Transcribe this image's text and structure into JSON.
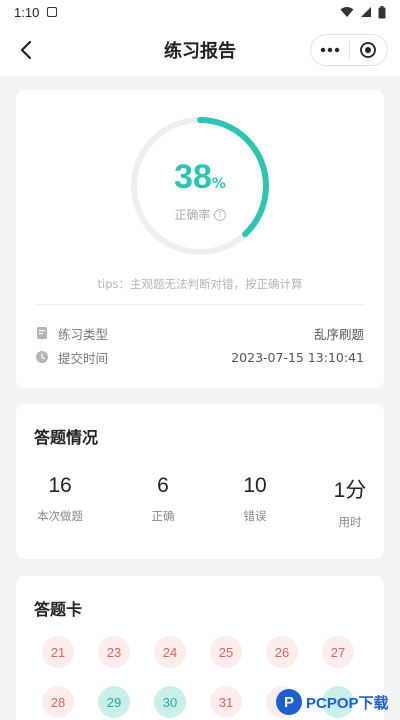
{
  "status_bar": {
    "time": "1:10"
  },
  "nav": {
    "title": "练习报告"
  },
  "report": {
    "accuracy_value": "38",
    "accuracy_unit": "%",
    "accuracy_fraction": 0.38,
    "accuracy_label": "正确率",
    "help_glyph": "?",
    "tips": "tips：主观题无法判断对错，按正确计算",
    "type_label": "练习类型",
    "type_value": "乱序刷题",
    "submit_label": "提交时间",
    "submit_value": "2023-07-15 13:10:41"
  },
  "summary": {
    "title": "答题情况",
    "stats": [
      {
        "value": "16",
        "label": "本次做题"
      },
      {
        "value": "6",
        "label": "正确"
      },
      {
        "value": "10",
        "label": "错误"
      },
      {
        "value": "1分",
        "label": "用时"
      }
    ]
  },
  "answer_card": {
    "title": "答题卡",
    "items": [
      {
        "num": "21",
        "status": "wrong"
      },
      {
        "num": "23",
        "status": "wrong"
      },
      {
        "num": "24",
        "status": "wrong"
      },
      {
        "num": "25",
        "status": "wrong"
      },
      {
        "num": "26",
        "status": "wrong"
      },
      {
        "num": "27",
        "status": "wrong"
      },
      {
        "num": "28",
        "status": "wrong"
      },
      {
        "num": "29",
        "status": "right"
      },
      {
        "num": "30",
        "status": "right"
      },
      {
        "num": "31",
        "status": "wrong"
      },
      {
        "num": "",
        "status": "wrong"
      },
      {
        "num": "",
        "status": "right"
      }
    ]
  },
  "watermark": {
    "logo_letter": "P",
    "text": "PCPOP下载"
  },
  "colors": {
    "accent": "#2ec5b0",
    "wrong_bg": "#fdecec",
    "wrong_fg": "#e8625c",
    "right_bg": "#c9efe8",
    "right_fg": "#2aa894"
  }
}
